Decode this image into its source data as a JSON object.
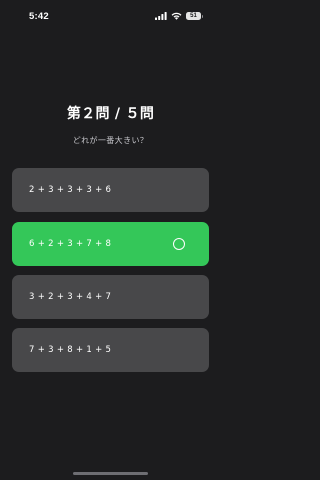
{
  "status_bar": {
    "time": "5:42",
    "battery_level": "51",
    "icons": [
      "cellular-signal-icon",
      "wifi-icon",
      "battery-icon"
    ]
  },
  "quiz": {
    "title": "第２問 / ５問",
    "question": "どれが一番大きい？"
  },
  "choices": [
    {
      "label": "2 + 3 + 3 + 3 + 6",
      "selected": false
    },
    {
      "label": "6 + 2 + 3 + 7 + 8",
      "selected": true
    },
    {
      "label": "3 + 2 + 3 + 4 + 7",
      "selected": false
    },
    {
      "label": "7 + 3 + 8 + 1 + 5",
      "selected": false
    }
  ],
  "colors": {
    "background": "#1c1c1e",
    "choice_default": "#48484a",
    "choice_selected": "#34c759"
  }
}
